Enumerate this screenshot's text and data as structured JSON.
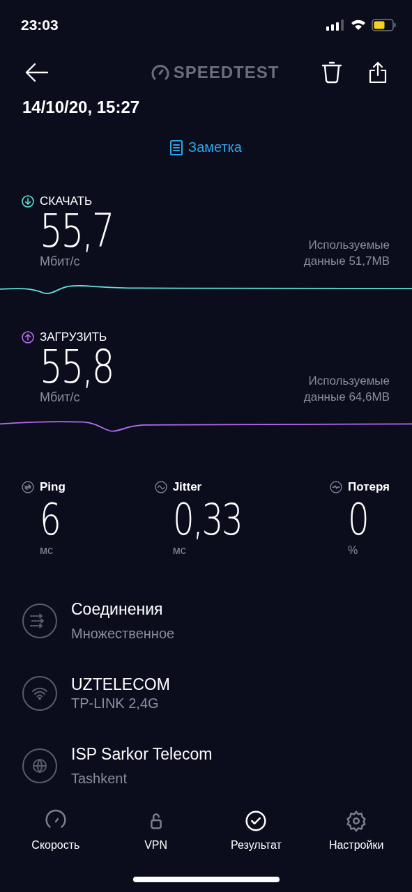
{
  "status_bar": {
    "time": "23:03"
  },
  "header": {
    "logo": "SPEEDTEST"
  },
  "date": "14/10/20, 15:27",
  "note_link": "Заметка",
  "measurements": [
    {
      "kind": "download",
      "label": "СКАЧАТЬ",
      "value": "55,7",
      "unit": "Мбит/с",
      "data_used": "Используемые",
      "data_amount": "данные 51,7MB",
      "color": "#5fe3d6"
    },
    {
      "kind": "upload",
      "label": "ЗАГРУЗИТЬ",
      "value": "55,8",
      "unit": "Мбит/с",
      "data_used": "Используемые",
      "data_amount": "данные 64,6MB",
      "color": "#b46cf0"
    }
  ],
  "stats": [
    {
      "kind": "ping",
      "label": "Ping",
      "value": "6",
      "unit": "мс"
    },
    {
      "kind": "jitter",
      "label": "Jitter",
      "value": "0,33",
      "unit": "мс"
    },
    {
      "kind": "loss",
      "label": "Потеря",
      "value": "0",
      "unit": "%"
    }
  ],
  "details": [
    {
      "kind": "connections",
      "title": "Соединения",
      "subtitle": "Множественное"
    },
    {
      "kind": "wifi",
      "title": "UZTELECOM",
      "subtitle": "TP-LINK  2,4G"
    },
    {
      "kind": "isp",
      "title": "ISP Sarkor Telecom",
      "subtitle": "Tashkent"
    }
  ],
  "tabs": [
    {
      "kind": "speed",
      "label": "Скорость",
      "selected": false
    },
    {
      "kind": "vpn",
      "label": "VPN",
      "selected": false
    },
    {
      "kind": "result",
      "label": "Результат",
      "selected": true
    },
    {
      "kind": "settings",
      "label": "Настройки",
      "selected": false
    }
  ]
}
